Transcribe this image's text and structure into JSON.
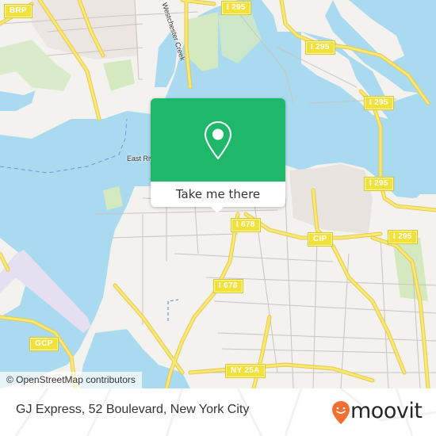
{
  "map": {
    "attribution": "© OpenStreetMap contributors",
    "colors": {
      "water": "#aadaef",
      "land": "#f3f2ee",
      "park": "#d4e9c0",
      "highway": "#f5de58",
      "shield": "#f1e13a",
      "accent_green": "#1fb86a",
      "moovit_orange": "#f36f31"
    },
    "shields": [
      {
        "label": "BRP"
      },
      {
        "label": "I 295"
      },
      {
        "label": "I 295"
      },
      {
        "label": "I 295"
      },
      {
        "label": "I 295"
      },
      {
        "label": "I 295"
      },
      {
        "label": "I 678"
      },
      {
        "label": "CIP"
      },
      {
        "label": "I 678"
      },
      {
        "label": "GCP"
      },
      {
        "label": "NY 25A"
      }
    ],
    "labels": {
      "creek": "Westchester Creek",
      "river": "East River"
    }
  },
  "popup": {
    "icon": "location-pin-icon",
    "action_label": "Take me there"
  },
  "footer": {
    "place_title": "GJ Express, 52 Boulevard, New York City",
    "brand": "moovit",
    "brand_icon": "moovit-smiley-pin-icon"
  }
}
